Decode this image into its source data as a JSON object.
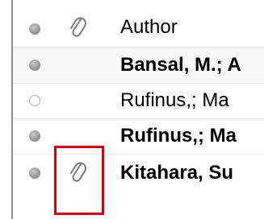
{
  "columns": {
    "author_header": "Author"
  },
  "rows": [
    {
      "author": "Bansal, M.; A",
      "bold": true,
      "read": false,
      "attachment": false
    },
    {
      "author": "Rufinus,; Ma",
      "bold": false,
      "read": true,
      "attachment": false
    },
    {
      "author": "Rufinus,; Ma",
      "bold": true,
      "read": false,
      "attachment": false
    },
    {
      "author": "Kitahara, Su",
      "bold": true,
      "read": false,
      "attachment": true
    }
  ],
  "icons": {
    "header_status": "status-dot-icon",
    "header_attachment": "paperclip-icon",
    "row_attachment": "paperclip-icon"
  },
  "colors": {
    "highlight": "#e30000"
  }
}
